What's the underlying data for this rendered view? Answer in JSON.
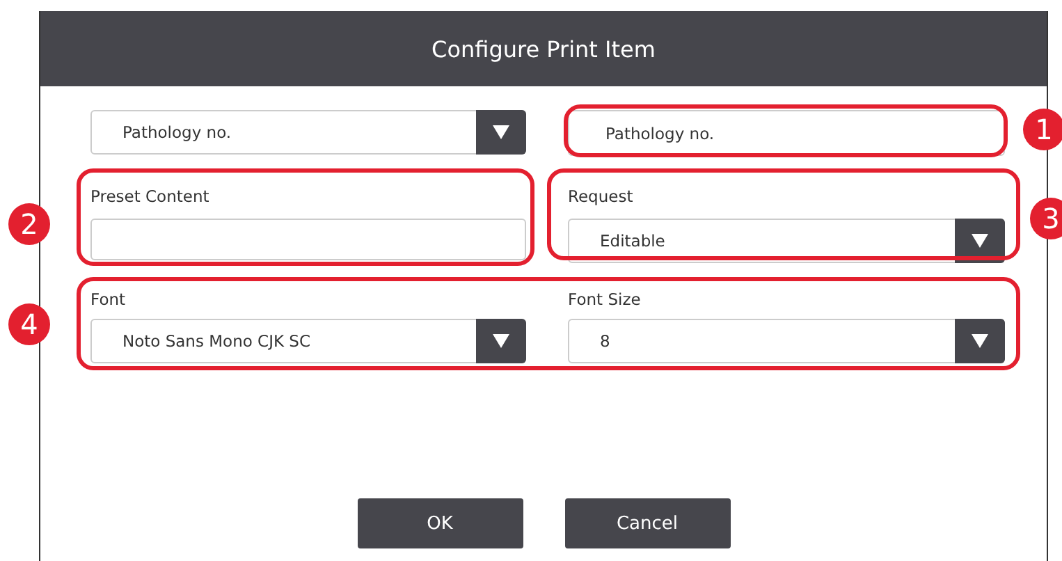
{
  "dialog": {
    "title": "Configure Print Item"
  },
  "rows": [
    [
      {
        "kind": "select",
        "value": "Pathology no."
      },
      {
        "kind": "input",
        "value": "Pathology no."
      }
    ],
    [
      {
        "kind": "input",
        "label": "Preset Content"
      },
      {
        "kind": "select",
        "label": "Request",
        "value": "Editable"
      }
    ],
    [
      {
        "kind": "select",
        "label": "Font",
        "value": "Noto Sans Mono CJK SC"
      },
      {
        "kind": "select",
        "label": "Font Size",
        "value": "8"
      }
    ]
  ],
  "buttons": [
    {
      "label": "OK"
    },
    {
      "label": "Cancel"
    }
  ],
  "callouts": [
    {
      "number": "1"
    },
    {
      "number": "2"
    },
    {
      "number": "3"
    },
    {
      "number": "4"
    }
  ]
}
